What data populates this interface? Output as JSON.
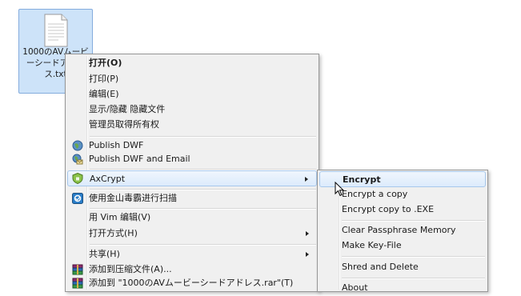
{
  "desktop": {
    "file": {
      "label": "1000のAVムービーシードアドレス.txt",
      "icon": "text-file-icon"
    }
  },
  "context_menu": {
    "items": [
      {
        "label": "打开(O)"
      },
      {
        "label": "打印(P)"
      },
      {
        "label": "编辑(E)"
      },
      {
        "label": "显示/隐藏 隐藏文件"
      },
      {
        "label": "管理员取得所有权"
      },
      {
        "label": "Publish DWF",
        "icon": "globe-icon"
      },
      {
        "label": "Publish DWF and Email",
        "icon": "globe-email-icon"
      },
      {
        "label": "AxCrypt",
        "icon": "shield-icon",
        "submenu": true
      },
      {
        "label": "使用金山毒霸进行扫描",
        "icon": "antivirus-icon"
      },
      {
        "label": "用 Vim 编辑(V)"
      },
      {
        "label": "打开方式(H)",
        "submenu": true
      },
      {
        "label": "共享(H)",
        "submenu": true
      },
      {
        "label": "添加到压缩文件(A)...",
        "icon": "winrar-icon"
      },
      {
        "label": "添加到 \"1000のAVムービーシードアドレス.rar\"(T)",
        "icon": "winrar-icon"
      }
    ]
  },
  "axcrypt_submenu": {
    "items": [
      {
        "label": "Encrypt"
      },
      {
        "label": "Encrypt a copy"
      },
      {
        "label": "Encrypt copy to .EXE"
      },
      {
        "label": "Clear Passphrase Memory"
      },
      {
        "label": "Make Key-File"
      },
      {
        "label": "Shred and Delete"
      },
      {
        "label": "About"
      }
    ]
  },
  "colors": {
    "menu_bg": "#f0f0f0",
    "highlight": "#dcebfc",
    "selection": "#cde3f9",
    "shield": "#8bc34a"
  }
}
